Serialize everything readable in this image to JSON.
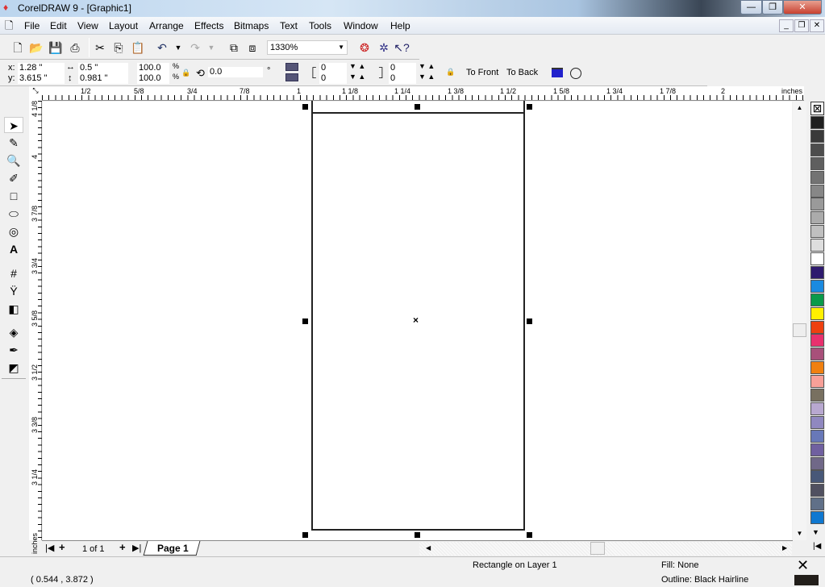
{
  "window": {
    "title": "CorelDRAW 9 - [Graphic1]",
    "minimize": "—",
    "restore": "❐",
    "close": "✕"
  },
  "menu": [
    "File",
    "Edit",
    "View",
    "Layout",
    "Arrange",
    "Effects",
    "Bitmaps",
    "Text",
    "Tools",
    "Window",
    "Help"
  ],
  "toolbar": {
    "zoom_level": "1330%"
  },
  "property_bar": {
    "x_label": "x:",
    "x": "1.28 \"",
    "y_label": "y:",
    "y": "3.615 \"",
    "width": "0.5 \"",
    "height": "0.981 \"",
    "scale_x": "100.0",
    "scale_y": "100.0",
    "percent": "%",
    "rotation": "0.0",
    "degree": "°",
    "corner_tl": "0",
    "corner_bl": "0",
    "corner_tr": "0",
    "corner_br": "0",
    "to_front": "To Front",
    "to_back": "To Back"
  },
  "ruler": {
    "h_labels": [
      "1/2",
      "5/8",
      "3/4",
      "7/8",
      "1",
      "1 1/8",
      "1 1/4",
      "1 3/8",
      "1 1/2",
      "1 5/8",
      "1 3/4",
      "1 7/8",
      "2"
    ],
    "units": "inches",
    "v_labels": [
      "4 1/8",
      "4",
      "3 7/8",
      "3 3/4",
      "3 5/8",
      "3 1/2",
      "3 3/8",
      "3 1/4"
    ]
  },
  "page_nav": {
    "count": "1 of 1",
    "tab": "Page 1"
  },
  "status": {
    "coords": "( 0.544 , 3.872 )",
    "selection": "Rectangle on Layer 1",
    "fill": "Fill: None",
    "outline": "Outline: Black  Hairline"
  },
  "palette": [
    "#1f1f1f",
    "#3a3a3a",
    "#4d4d4d",
    "#5f5f5f",
    "#737373",
    "#878787",
    "#9a9a9a",
    "#ababab",
    "#c0c0c0",
    "#dedede",
    "#ffffff",
    "#2e1a6e",
    "#1a8ae0",
    "#0a9a4a",
    "#fff000",
    "#ee4010",
    "#e8306e",
    "#a8507a",
    "#f08010",
    "#f8a098",
    "#787060",
    "#b8a8d0",
    "#9088c0",
    "#6878b8",
    "#7060a0",
    "#706888",
    "#485878",
    "#505060",
    "#607088",
    "#1078d0"
  ],
  "tools": [
    "pick-tool",
    "shape-tool",
    "zoom-tool",
    "freehand-tool",
    "rectangle-tool",
    "ellipse-tool",
    "spiral-tool",
    "text-tool",
    "interactive-fill-tool",
    "eyedropper-tool",
    "blend-tool",
    "fill-tool",
    "outline-tool",
    "paint-bucket-tool"
  ]
}
